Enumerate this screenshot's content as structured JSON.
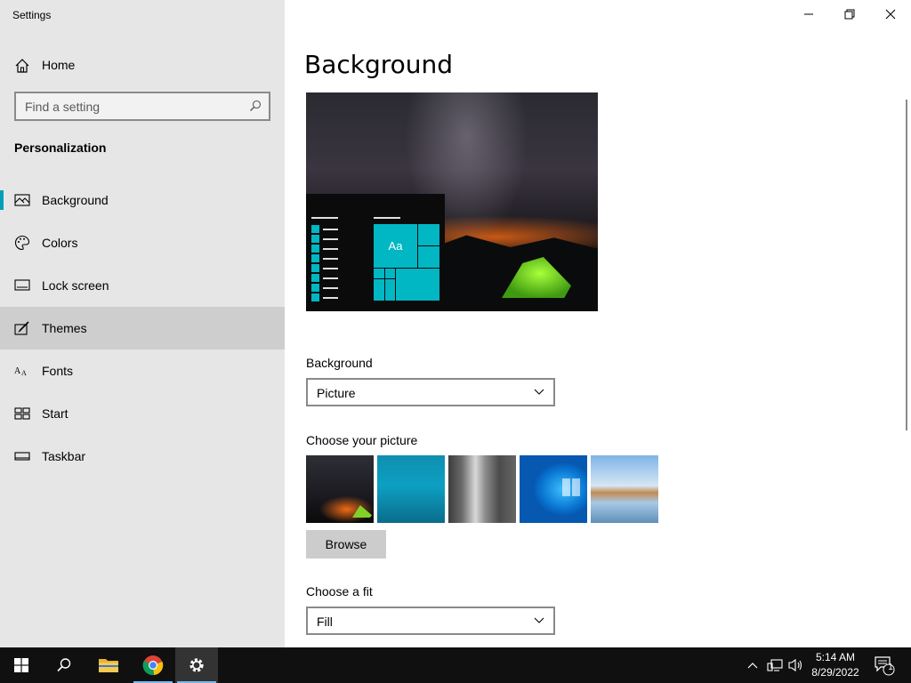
{
  "app": {
    "title": "Settings"
  },
  "sidebar": {
    "home_label": "Home",
    "search_placeholder": "Find a setting",
    "section_title": "Personalization",
    "items": [
      {
        "label": "Background",
        "icon": "picture-icon",
        "active": true
      },
      {
        "label": "Colors",
        "icon": "palette-icon"
      },
      {
        "label": "Lock screen",
        "icon": "lock-screen-icon"
      },
      {
        "label": "Themes",
        "icon": "brush-icon",
        "hover": true
      },
      {
        "label": "Fonts",
        "icon": "font-icon"
      },
      {
        "label": "Start",
        "icon": "start-tiles-icon"
      },
      {
        "label": "Taskbar",
        "icon": "taskbar-icon"
      }
    ]
  },
  "main": {
    "title": "Background",
    "preview": {
      "tile_text": "Aa"
    },
    "background_label": "Background",
    "background_value": "Picture",
    "choose_picture_label": "Choose your picture",
    "browse_label": "Browse",
    "choose_fit_label": "Choose a fit",
    "fit_value": "Fill"
  },
  "taskbar": {
    "time": "5:14 AM",
    "date": "8/29/2022",
    "notification_count": "1"
  },
  "colors": {
    "accent": "#00b7c3",
    "sidebar_bg": "#e6e6e6",
    "taskbar_bg": "#101010"
  }
}
